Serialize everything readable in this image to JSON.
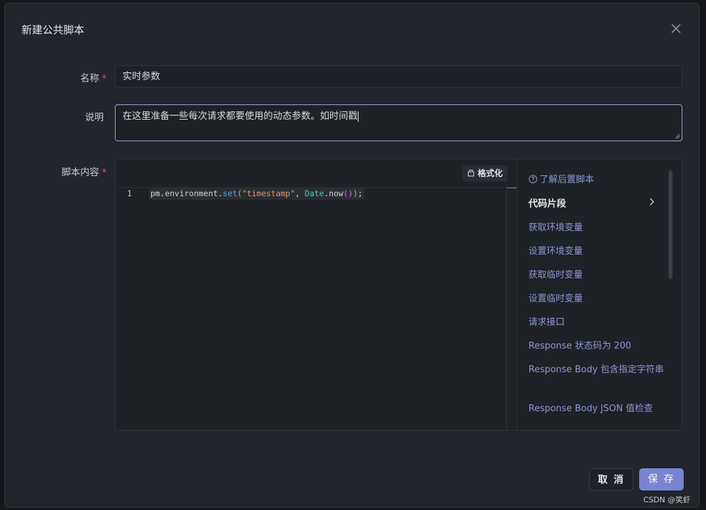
{
  "dialog": {
    "title": "新建公共脚本"
  },
  "form": {
    "name_label": "名称",
    "name_value": "实时参数",
    "desc_label": "说明",
    "desc_value": "在这里准备一些每次请求都要使用的动态参数。如时间戳",
    "script_label": "脚本内容",
    "required_mark": "*"
  },
  "editor": {
    "format_label": "格式化",
    "line_number": "1",
    "tokens": {
      "obj": "pm",
      "dot1": ".",
      "prop": "environment",
      "dot2": ".",
      "method": "set",
      "paren_open": "(",
      "str": "\"timestamp\"",
      "comma": ", ",
      "cls": "Date",
      "dot3": ".",
      "now": "now",
      "inner_parens": "()",
      "paren_close": ")",
      "semi": ";"
    }
  },
  "sidebar": {
    "help_link": "了解后置脚本",
    "snippets_title": "代码片段",
    "snippets": [
      "获取环境变量",
      "设置环境变量",
      "获取临时变量",
      "设置临时变量",
      "请求接口",
      "Response 状态码为 200",
      "Response Body 包含指定字符串",
      "Response Body JSON 值检查"
    ]
  },
  "footer": {
    "cancel_label": "取 消",
    "save_label": "保 存"
  },
  "watermark": "CSDN @笑虾",
  "colors": {
    "accent": "#7985d0",
    "link": "#8f98d4",
    "required": "#e0565b"
  }
}
